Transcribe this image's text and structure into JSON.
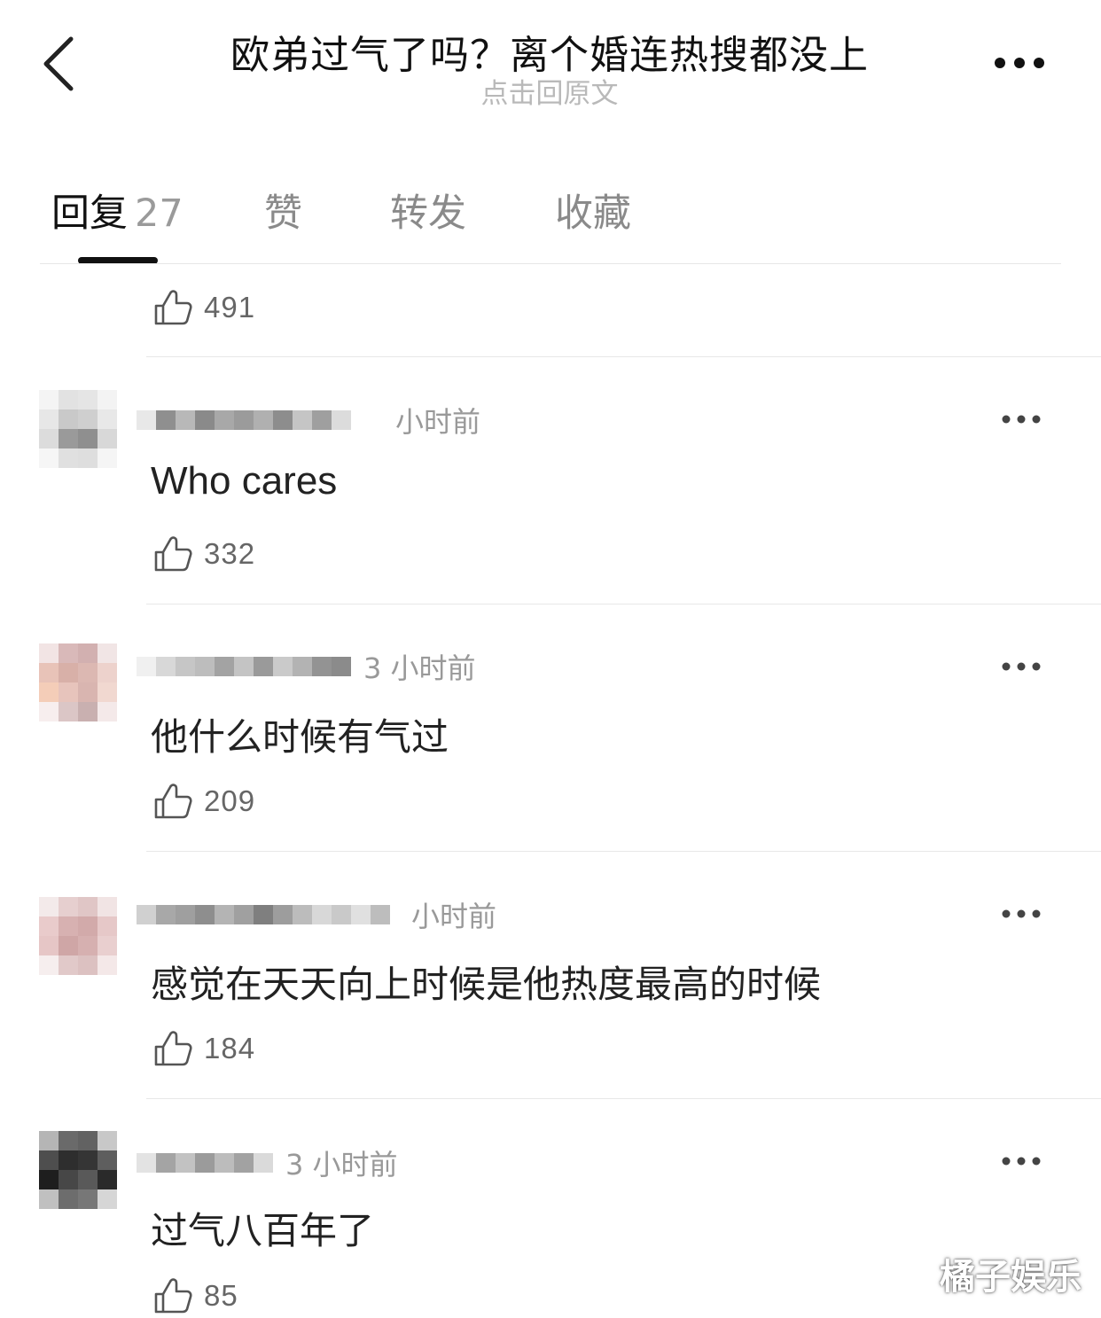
{
  "header": {
    "title": "欧弟过气了吗？离个婚连热搜都没上",
    "subtitle": "点击回原文"
  },
  "tabs": {
    "reply_label": "回复",
    "reply_count": "27",
    "like_label": "赞",
    "repost_label": "转发",
    "fav_label": "收藏"
  },
  "top_partial": {
    "likes": "491"
  },
  "comments": [
    {
      "time": "小时前",
      "text": "Who cares",
      "likes": "332"
    },
    {
      "time": "3 小时前",
      "text": "他什么时候有气过",
      "likes": "209"
    },
    {
      "time": "小时前",
      "text": "感觉在天天向上时候是他热度最高的时候",
      "likes": "184"
    },
    {
      "time": "3 小时前",
      "text": "过气八百年了",
      "likes": "85"
    }
  ],
  "watermark": "橘子娱乐",
  "icons": {
    "back": "chevron-left-icon",
    "more": "more-dots-icon",
    "like": "thumbs-up-icon"
  }
}
